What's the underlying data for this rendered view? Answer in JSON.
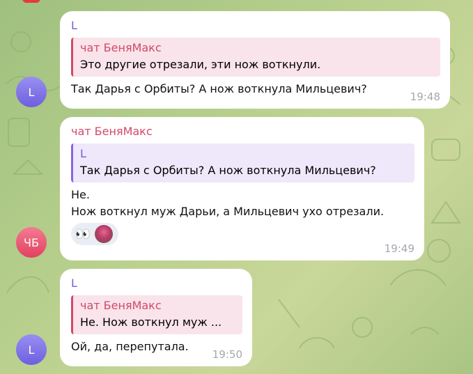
{
  "messages": [
    {
      "avatar_initials": "L",
      "sender": "L",
      "quote": {
        "sender": "чат БеняМакс",
        "text": "Это другие отрезали, эти нож воткнули."
      },
      "text_lines": [
        "Так Дарья с Орбиты? А нож воткнула Мильцевич?"
      ],
      "time": "19:48"
    },
    {
      "avatar_initials": "ЧБ",
      "sender": "чат БеняМакс",
      "quote": {
        "sender": "L",
        "text": "Так Дарья с Орбиты? А нож воткнула Мильцевич?"
      },
      "text_lines": [
        "Не.",
        "Нож воткнул муж Дарьи, а Мильцевич ухо отрезали."
      ],
      "reactions": {
        "emoji": "👀",
        "user_avatar": "reaction-user-avatar"
      },
      "time": "19:49"
    },
    {
      "avatar_initials": "L",
      "sender": "L",
      "quote": {
        "sender": "чат БеняМакс",
        "text": "Не.  Нож воткнул муж ..."
      },
      "text_lines": [
        "Ой, да, перепутала."
      ],
      "time": "19:50"
    }
  ],
  "colors": {
    "sender_l": "#7a5bd6",
    "sender_cb": "#d2486a",
    "avatar_l": "#7b6de6",
    "avatar_cb": "#e8506e"
  }
}
